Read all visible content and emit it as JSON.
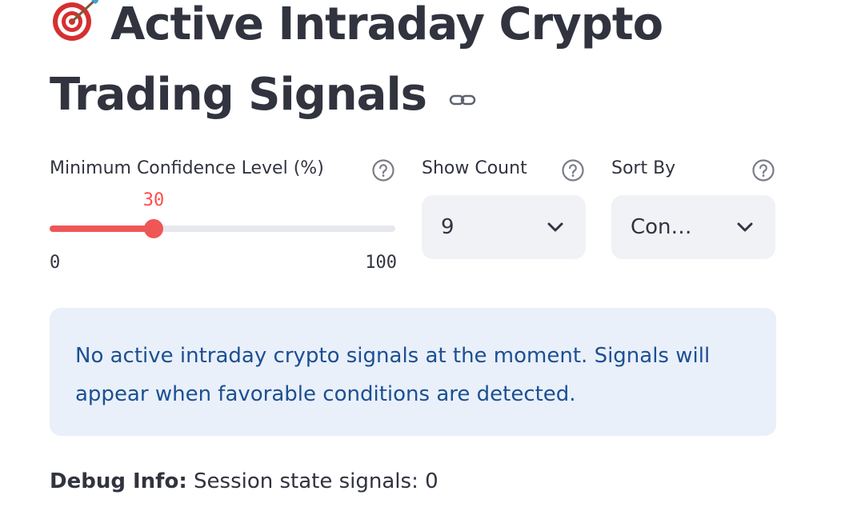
{
  "header": {
    "emoji": "🎯",
    "title_line1": "Active Intraday Crypto",
    "title_line2": "Trading Signals"
  },
  "controls": {
    "confidence": {
      "label": "Minimum Confidence Level (%)",
      "value": "30",
      "min": "0",
      "max": "100",
      "fill_fraction": 0.3
    },
    "show_count": {
      "label": "Show Count",
      "value": "9"
    },
    "sort_by": {
      "label": "Sort By",
      "value": "Con…"
    }
  },
  "alert": {
    "text": "No active intraday crypto signals at the moment. Signals will appear when favorable conditions are detected."
  },
  "debug": {
    "label": "Debug Info:",
    "text": " Session state signals: 0"
  },
  "colors": {
    "accent": "#ef5656",
    "slider_value": "#ff4b4b",
    "alert_bg": "#e9f0fa",
    "alert_text": "#1d4f91",
    "select_bg": "#f0f2f6",
    "text": "#31333f"
  },
  "icons": [
    "dart-target-icon",
    "link-icon",
    "help-icon",
    "chevron-down-icon"
  ]
}
